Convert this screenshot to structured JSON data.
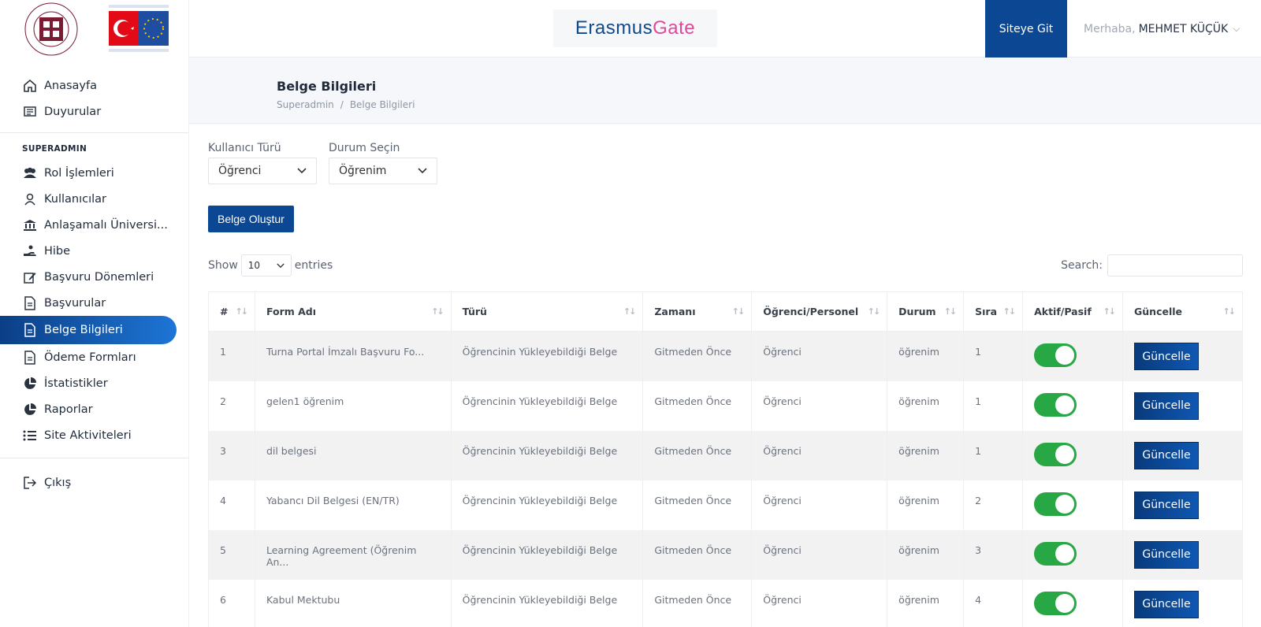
{
  "header": {
    "brand_part1": "Erasmus",
    "brand_part2": "Gate",
    "site_button": "Siteye Git",
    "greeting": "Merhaba,",
    "user_name": "MEHMET KÜÇÜK"
  },
  "sidebar": {
    "top_items": [
      {
        "label": "Anasayfa",
        "icon": "home-icon"
      },
      {
        "label": "Duyurular",
        "icon": "newspaper-icon"
      }
    ],
    "section_title": "SUPERADMIN",
    "admin_items": [
      {
        "label": "Rol İşlemleri",
        "icon": "users-icon"
      },
      {
        "label": "Kullanıcılar",
        "icon": "user-icon"
      },
      {
        "label": "Anlaşamalı Üniversi...",
        "icon": "university-icon"
      },
      {
        "label": "Hibe",
        "icon": "hand-coin-icon"
      },
      {
        "label": "Başvuru Dönemleri",
        "icon": "edit-icon"
      },
      {
        "label": "Başvurular",
        "icon": "document-icon"
      },
      {
        "label": "Belge Bilgileri",
        "icon": "document-icon"
      },
      {
        "label": "Ödeme Formları",
        "icon": "document-icon"
      },
      {
        "label": "İstatistikler",
        "icon": "pie-chart-icon"
      },
      {
        "label": "Raporlar",
        "icon": "pie-chart-icon"
      },
      {
        "label": "Site Aktiviteleri",
        "icon": "list-icon"
      }
    ],
    "logout": "Çıkış",
    "active_color": "#0b3f86"
  },
  "page": {
    "title": "Belge Bilgileri",
    "breadcrumb": [
      "Superadmin",
      "Belge Bilgileri"
    ]
  },
  "filters": {
    "user_type_label": "Kullanıcı Türü",
    "user_type_value": "Öğrenci",
    "status_label": "Durum Seçin",
    "status_value": "Öğrenim"
  },
  "create_button": "Belge Oluştur",
  "table_controls": {
    "show": "Show",
    "entries_value": "10",
    "entries": "entries",
    "search_label": "Search:"
  },
  "table": {
    "columns": [
      "#",
      "Form Adı",
      "Türü",
      "Zamanı",
      "Öğrenci/Personel",
      "Durum",
      "Sıra",
      "Aktif/Pasif",
      "Güncelle"
    ],
    "update_label": "Güncelle",
    "rows": [
      {
        "no": "1",
        "form": "Turna Portal İmzalı Başvuru Fo...",
        "type": "Öğrencinin Yükleyebildiği Belge",
        "time": "Gitmeden Önce",
        "who": "Öğrenci",
        "status": "öğrenim",
        "order": "1",
        "active": true
      },
      {
        "no": "2",
        "form": "gelen1 öğrenim",
        "type": "Öğrencinin Yükleyebildiği Belge",
        "time": "Gitmeden Önce",
        "who": "Öğrenci",
        "status": "öğrenim",
        "order": "1",
        "active": true
      },
      {
        "no": "3",
        "form": "dil belgesi",
        "type": "Öğrencinin Yükleyebildiği Belge",
        "time": "Gitmeden Önce",
        "who": "Öğrenci",
        "status": "öğrenim",
        "order": "1",
        "active": true
      },
      {
        "no": "4",
        "form": "Yabancı Dil Belgesi (EN/TR)",
        "type": "Öğrencinin Yükleyebildiği Belge",
        "time": "Gitmeden Önce",
        "who": "Öğrenci",
        "status": "öğrenim",
        "order": "2",
        "active": true
      },
      {
        "no": "5",
        "form": "Learning Agreement (Öğrenim An...",
        "type": "Öğrencinin Yükleyebildiği Belge",
        "time": "Gitmeden Önce",
        "who": "Öğrenci",
        "status": "öğrenim",
        "order": "3",
        "active": true
      },
      {
        "no": "6",
        "form": "Kabul Mektubu",
        "type": "Öğrencinin Yükleyebildiği Belge",
        "time": "Gitmeden Önce",
        "who": "Öğrenci",
        "status": "öğrenim",
        "order": "4",
        "active": true
      }
    ]
  }
}
